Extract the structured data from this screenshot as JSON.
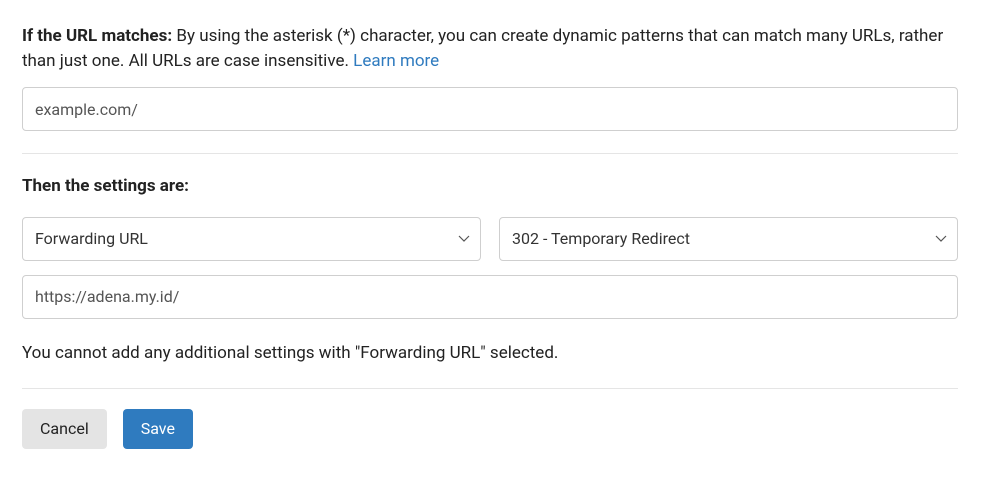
{
  "url_match": {
    "label_bold": "If the URL matches:",
    "label_rest": " By using the asterisk (*) character, you can create dynamic patterns that can match many URLs, rather than just one. All URLs are case insensitive. ",
    "learn_more": "Learn more",
    "value": "example.com/"
  },
  "settings": {
    "heading": "Then the settings are:",
    "setting_select": "Forwarding URL",
    "redirect_select": "302 - Temporary Redirect",
    "destination_value": "https://adena.my.id/",
    "notice": "You cannot add any additional settings with \"Forwarding URL\" selected."
  },
  "buttons": {
    "cancel": "Cancel",
    "save": "Save"
  }
}
